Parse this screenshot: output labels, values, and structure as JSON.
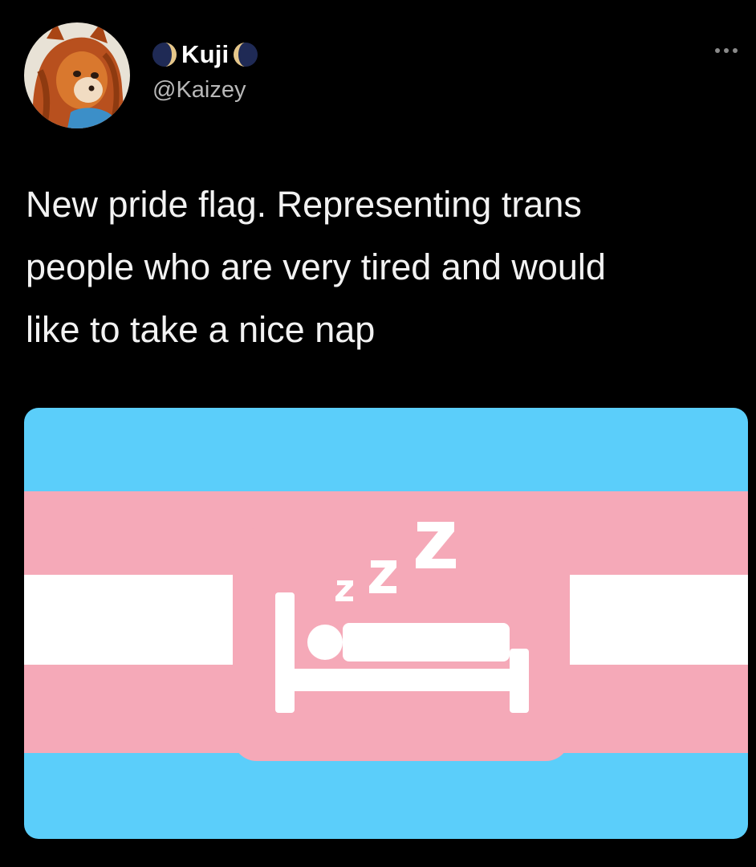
{
  "tweet": {
    "display_name": "Kuji",
    "handle": "@Kaizey",
    "text": "New pride flag. Representing trans\npeople who are very tired and would\nlike to take a nice nap",
    "avatar_icon": "fox-character-avatar",
    "name_decorations": [
      "waning-moon-icon",
      "waxing-moon-icon"
    ],
    "more_icon": "more-options-icon"
  },
  "media": {
    "description_icons": [
      "bed-icon",
      "sleeping-person-icon",
      "zzz-icon"
    ],
    "zzz_text": "zZZ",
    "colors": {
      "blue": "#5BCEFA",
      "pink": "#F5A9B8",
      "white": "#FFFFFF",
      "background": "#000000",
      "text": "#F2F2F2",
      "handle": "#B8B8B8"
    }
  }
}
